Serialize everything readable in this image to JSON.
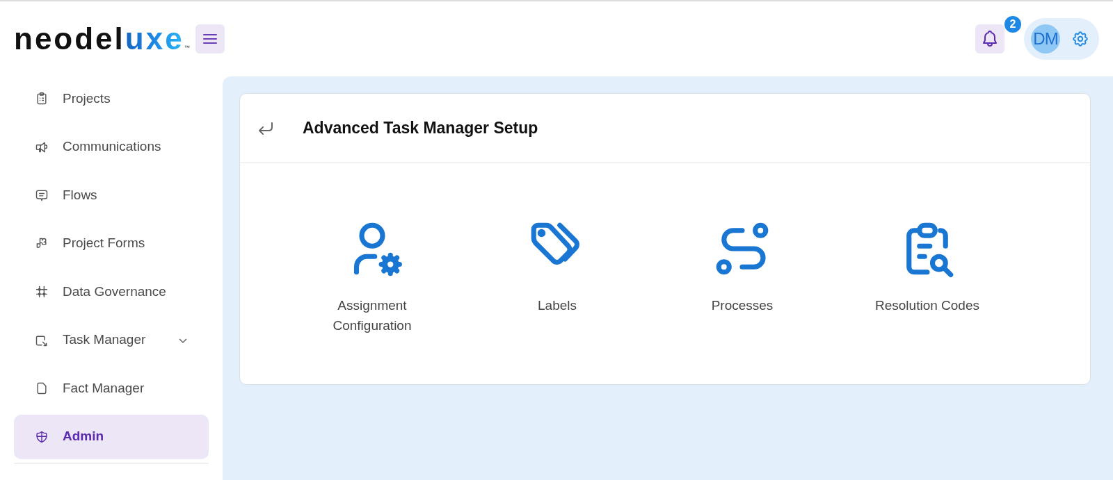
{
  "logo": {
    "main": "neodel",
    "accent": "uxe",
    "mark": "™"
  },
  "header": {
    "notifications": {
      "count": "2"
    },
    "avatar": {
      "initials": "DM"
    }
  },
  "sidebar": {
    "items": [
      {
        "label": "Projects",
        "selected": false
      },
      {
        "label": "Communications",
        "selected": false
      },
      {
        "label": "Flows",
        "selected": false
      },
      {
        "label": "Project Forms",
        "selected": false
      },
      {
        "label": "Data Governance",
        "selected": false
      },
      {
        "label": "Task Manager",
        "selected": false,
        "expanded": false
      },
      {
        "label": "Fact Manager",
        "selected": false
      },
      {
        "label": "Admin",
        "selected": true
      }
    ]
  },
  "card": {
    "title": "Advanced Task Manager Setup",
    "tiles": [
      {
        "label": "Assignment Configuration"
      },
      {
        "label": "Labels"
      },
      {
        "label": "Processes"
      },
      {
        "label": "Resolution Codes"
      }
    ]
  }
}
